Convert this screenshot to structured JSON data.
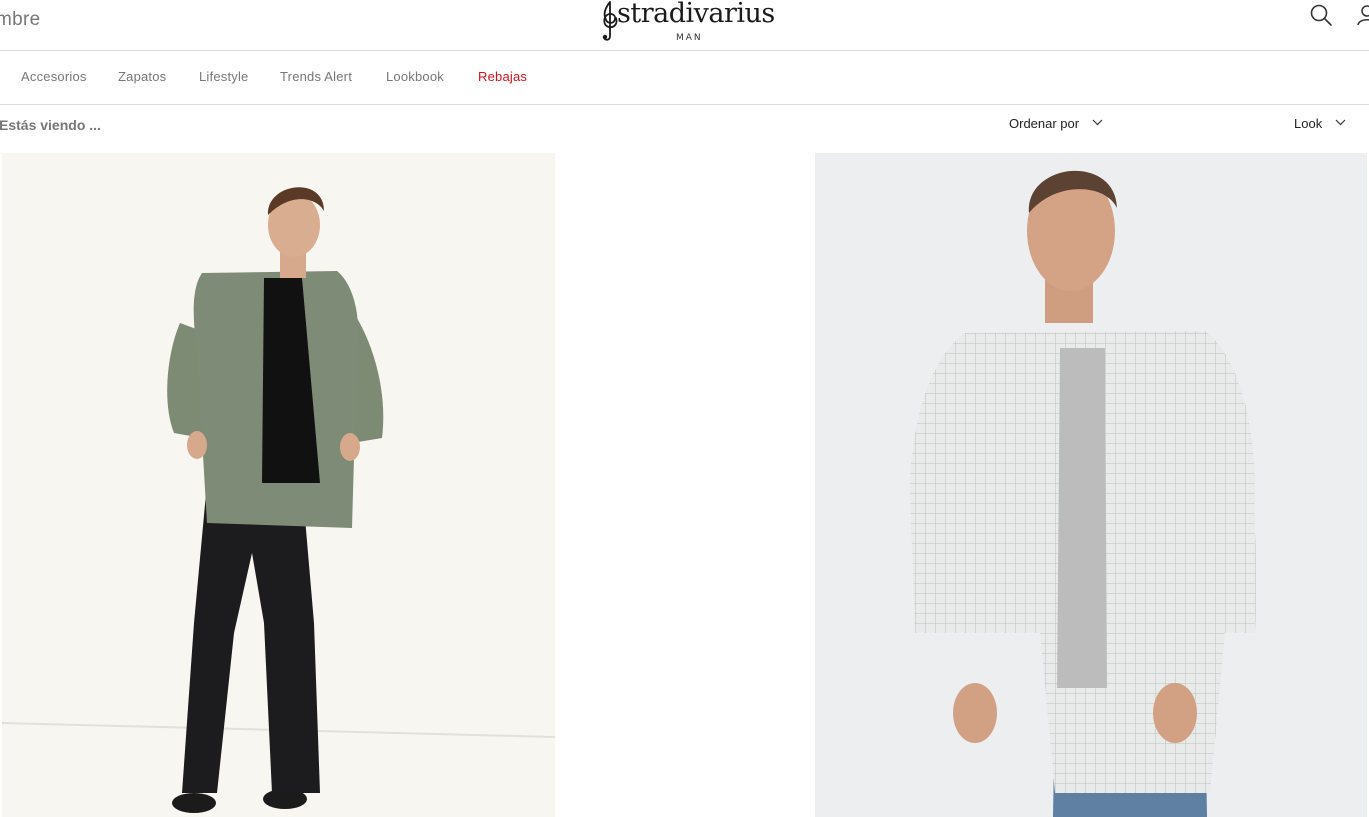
{
  "header": {
    "gender_tab": "mbre",
    "logo": {
      "wordmark": "stradivarius",
      "sub": "MAN"
    },
    "search_icon": "search-icon",
    "user_icon": "user-icon"
  },
  "nav": {
    "items": [
      {
        "label": "Accesorios"
      },
      {
        "label": "Zapatos"
      },
      {
        "label": "Lifestyle"
      },
      {
        "label": "Trends Alert"
      },
      {
        "label": "Lookbook"
      },
      {
        "label": "Rebajas",
        "highlight": true
      }
    ],
    "sale_color": "#d0121b"
  },
  "filters": {
    "viewing_label": "Estás viendo ...",
    "sort_label": "Ordenar por",
    "view_label": "Look"
  },
  "products": [
    {
      "image": "model-green-shirt-black-jeans"
    },
    {
      "image": "model-checked-shirt-blue-jeans"
    }
  ]
}
